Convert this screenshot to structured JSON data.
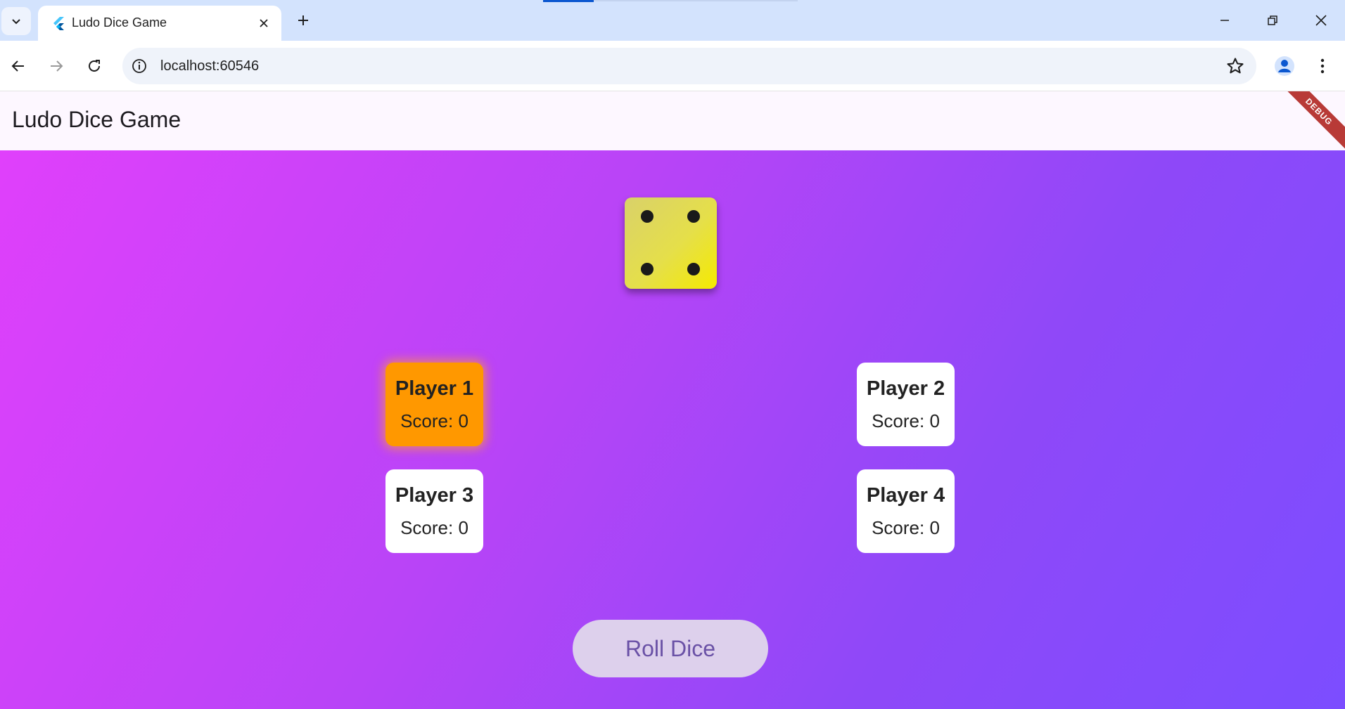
{
  "browser": {
    "tab_title": "Ludo Dice Game",
    "url": "localhost:60546"
  },
  "app": {
    "title": "Ludo Dice Game",
    "debug_label": "DEBUG",
    "dice_value": 4,
    "players": [
      {
        "name": "Player 1",
        "score": "Score: 0",
        "active": true
      },
      {
        "name": "Player 2",
        "score": "Score: 0",
        "active": false
      },
      {
        "name": "Player 3",
        "score": "Score: 0",
        "active": false
      },
      {
        "name": "Player 4",
        "score": "Score: 0",
        "active": false
      }
    ],
    "roll_button_label": "Roll Dice"
  },
  "colors": {
    "active_player": "#ff9800",
    "dice": "#f5ea00",
    "gradient_start": "#e040fb",
    "gradient_end": "#7c4dff",
    "roll_button_bg": "#ddd0ec",
    "roll_button_text": "#6a51a6"
  },
  "icons": {
    "tab_search": "chevron-down-icon",
    "favicon": "flutter-icon",
    "tab_close": "close-icon",
    "new_tab": "plus-icon",
    "back": "arrow-left-icon",
    "forward": "arrow-right-icon",
    "reload": "reload-icon",
    "site_info": "info-icon",
    "bookmark": "star-icon",
    "profile": "person-icon",
    "menu": "kebab-menu-icon"
  }
}
